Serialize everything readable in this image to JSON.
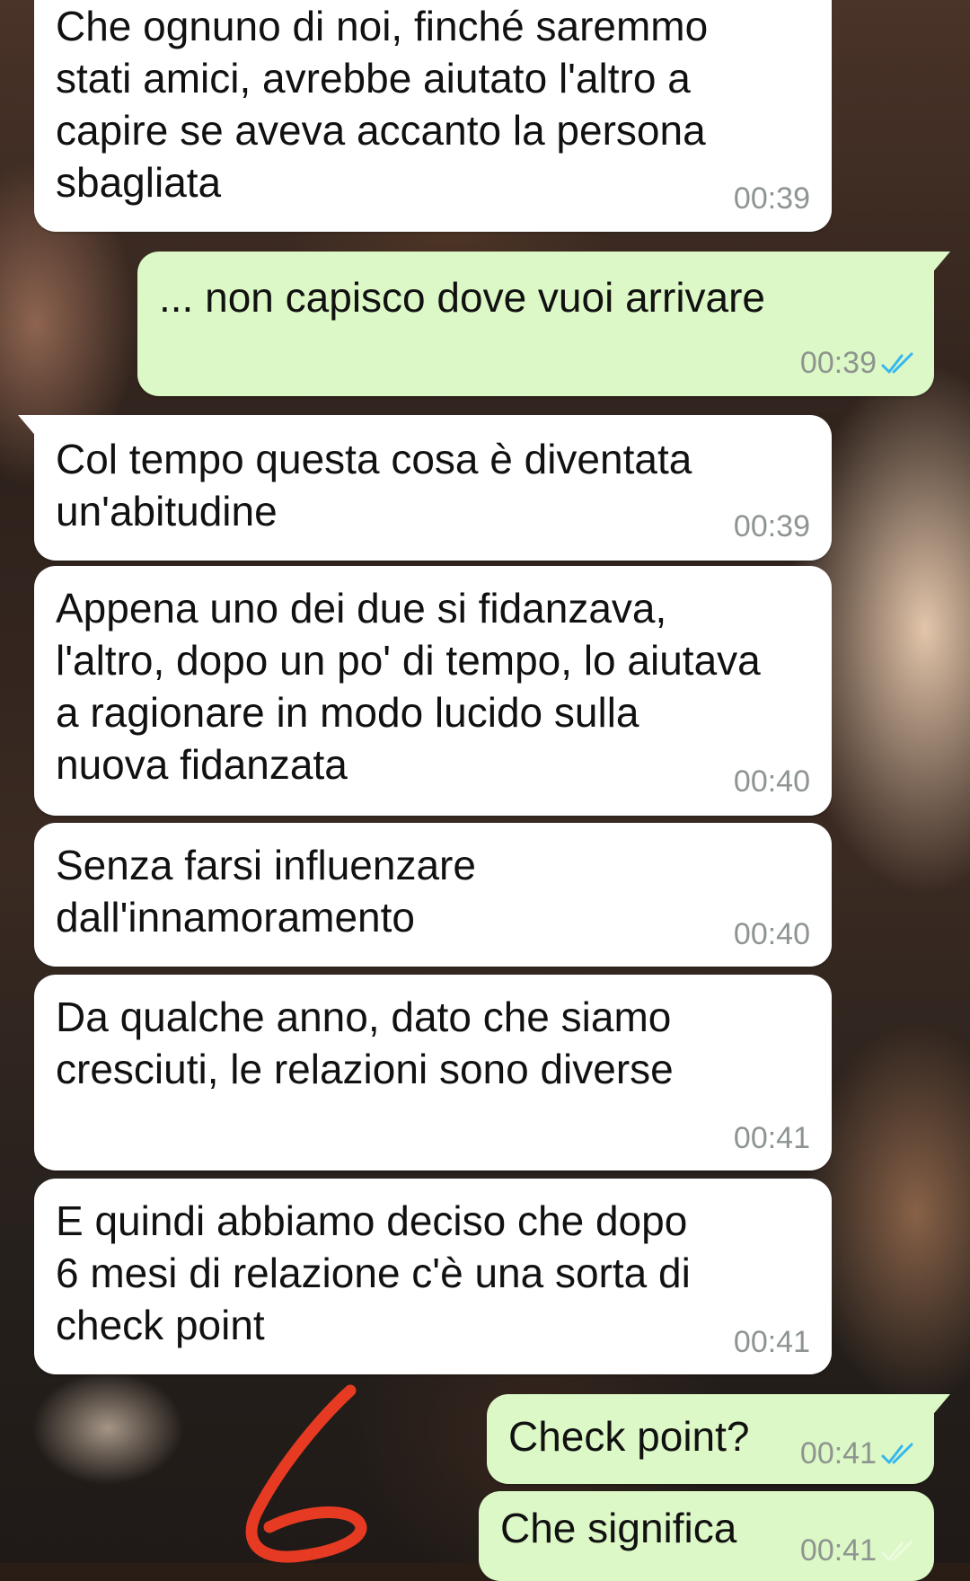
{
  "colors": {
    "incoming_bubble": "#ffffff",
    "outgoing_bubble": "#dcf8c6",
    "timestamp": "#8e9590",
    "read_ticks": "#34b7f1",
    "annotation_stroke": "#e63b22"
  },
  "annotation": {
    "glyph": "6",
    "icon": "handwritten-six-annotation"
  },
  "messages": [
    {
      "direction": "incoming",
      "text": "Che ognuno di noi, finché saremmo\nstati amici, avrebbe aiutato l'altro a\ncapire se aveva accanto la persona\nsbagliata",
      "time": "00:39"
    },
    {
      "direction": "outgoing",
      "text": "... non capisco dove vuoi arrivare",
      "time": "00:39",
      "status": "read"
    },
    {
      "direction": "incoming",
      "text": "Col tempo questa cosa è diventata\nun'abitudine",
      "time": "00:39"
    },
    {
      "direction": "incoming",
      "text": "Appena uno dei due si fidanzava,\nl'altro, dopo un po' di tempo, lo aiutava\na ragionare in modo lucido sulla\nnuova fidanzata",
      "time": "00:40"
    },
    {
      "direction": "incoming",
      "text": "Senza farsi influenzare\ndall'innamoramento",
      "time": "00:40"
    },
    {
      "direction": "incoming",
      "text": "Da qualche anno, dato che siamo\ncresciuti, le relazioni sono diverse",
      "time": "00:41"
    },
    {
      "direction": "incoming",
      "text": "E quindi abbiamo deciso che dopo\n6 mesi di relazione c'è una sorta di\ncheck point",
      "time": "00:41"
    },
    {
      "direction": "outgoing",
      "text": "Check point?",
      "time": "00:41",
      "status": "read"
    },
    {
      "direction": "outgoing",
      "text": "Che significa",
      "time": "00:41",
      "status": "read"
    }
  ]
}
